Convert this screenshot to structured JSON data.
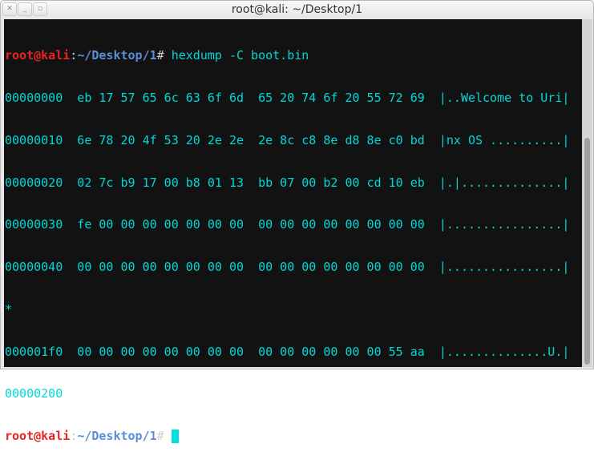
{
  "window": {
    "title": "root@kali: ~/Desktop/1",
    "buttons": [
      {
        "icon": "close-icon",
        "glyph": "✕"
      },
      {
        "icon": "minimize-icon",
        "glyph": "_"
      },
      {
        "icon": "maximize-icon",
        "glyph": "▫"
      }
    ]
  },
  "terminal": {
    "prompt": {
      "user": "root@kali",
      "sep": ":",
      "path": "~/Desktop/1",
      "sym": "#"
    },
    "command": " hexdump -C boot.bin",
    "output": [
      "00000000  eb 17 57 65 6c 63 6f 6d  65 20 74 6f 20 55 72 69  |..Welcome to Uri|",
      "00000010  6e 78 20 4f 53 20 2e 2e  2e 8c c8 8e d8 8e c0 bd  |nx OS ..........|",
      "00000020  02 7c b9 17 00 b8 01 13  bb 07 00 b2 00 cd 10 eb  |.|..............|",
      "00000030  fe 00 00 00 00 00 00 00  00 00 00 00 00 00 00 00  |................|",
      "00000040  00 00 00 00 00 00 00 00  00 00 00 00 00 00 00 00  |................|",
      "*",
      "000001f0  00 00 00 00 00 00 00 00  00 00 00 00 00 00 55 aa  |..............U.|",
      "00000200"
    ],
    "colors": {
      "background": "#121212",
      "text": "#00d8d8",
      "user": "#e82424",
      "path": "#5a8fd8"
    }
  },
  "scrollbar": {
    "position_fraction": 0.35
  }
}
